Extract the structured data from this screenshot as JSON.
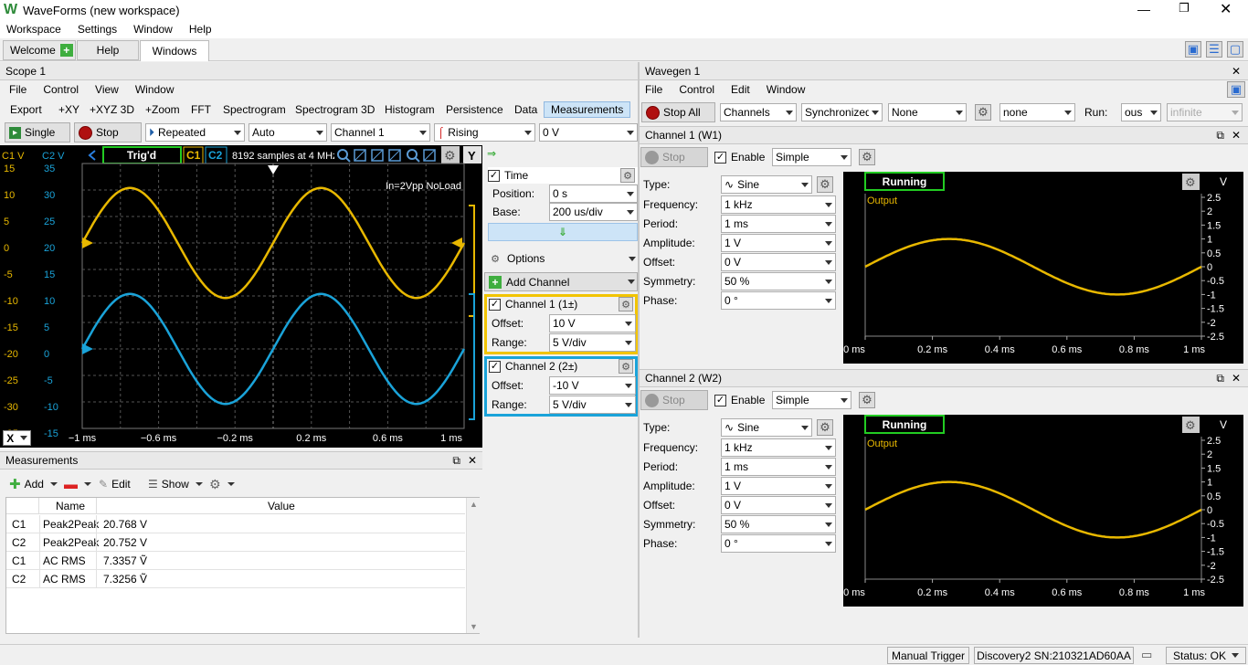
{
  "app": {
    "title": "WaveForms (new workspace)",
    "menu": [
      "Workspace",
      "Settings",
      "Window",
      "Help"
    ],
    "tabs": [
      "Welcome",
      "Help",
      "Windows"
    ]
  },
  "scope": {
    "pane_title": "Scope 1",
    "menu": [
      "File",
      "Control",
      "View",
      "Window"
    ],
    "toolbar": [
      "Export",
      "+XY",
      "+XYZ 3D",
      "+Zoom",
      "FFT",
      "Spectrogram",
      "Spectrogram 3D",
      "Histogram",
      "Persistence",
      "Data",
      "Measurements"
    ],
    "single_label": "Single",
    "stop_label": "Stop",
    "mode": "Repeated",
    "trigger_type": "Auto",
    "trigger_source": "Channel 1",
    "trigger_edge": "Rising",
    "trigger_level": "0 V",
    "c1_unit": "C1 V",
    "c2_unit": "C2 V",
    "status": "Trig'd",
    "c1_tag": "C1",
    "c2_tag": "C2",
    "samples": "8192 samples at 4 MHz",
    "annotation": "In=2Vpp NoLoad",
    "c1_ticks": [
      "15",
      "10",
      "5",
      "0",
      "-5",
      "-10",
      "-15",
      "-20",
      "-25",
      "-30",
      "-35"
    ],
    "c2_ticks": [
      "35",
      "30",
      "25",
      "20",
      "15",
      "10",
      "5",
      "0",
      "-5",
      "-10",
      "-15"
    ],
    "time_ticks": [
      "−1 ms",
      "−0.6 ms",
      "−0.2 ms",
      "0.2 ms",
      "0.6 ms",
      "1 ms"
    ],
    "x_label": "X",
    "colors": {
      "c1": "#e8b800",
      "c2": "#1aa3d9"
    }
  },
  "settings": {
    "time_label": "Time",
    "position_label": "Position:",
    "position": "0 s",
    "base_label": "Base:",
    "base": "200 us/div",
    "options_label": "Options",
    "add_channel_label": "Add Channel",
    "ch1_label": "Channel 1 (1±)",
    "ch1_offset": "10 V",
    "ch1_range": "5 V/div",
    "ch2_label": "Channel 2 (2±)",
    "ch2_offset": "-10 V",
    "ch2_range": "5 V/div",
    "offset_label": "Offset:",
    "range_label": "Range:"
  },
  "measurements": {
    "pane_title": "Measurements",
    "add": "Add",
    "edit": "Edit",
    "show": "Show",
    "headers": [
      "Name",
      "Value"
    ],
    "rows": [
      {
        "ch": "C1",
        "name": "Peak2Peak",
        "value": "20.768 V"
      },
      {
        "ch": "C2",
        "name": "Peak2Peak",
        "value": "20.752 V"
      },
      {
        "ch": "C1",
        "name": "AC RMS",
        "value": "7.3357 Ṽ"
      },
      {
        "ch": "C2",
        "name": "AC RMS",
        "value": "7.3256 Ṽ"
      }
    ]
  },
  "wavegen": {
    "pane_title": "Wavegen 1",
    "menu": [
      "File",
      "Control",
      "Edit",
      "Window"
    ],
    "stop_all": "Stop All",
    "channels": "Channels",
    "sync": "Synchronized",
    "trigger": "None",
    "source": "none",
    "run_label": "Run:",
    "run": "ous",
    "run_count": "infinite",
    "channel_panels": [
      {
        "title": "Channel 1 (W1)",
        "stop": "Stop",
        "enable": "Enable",
        "mode": "Simple",
        "type": "Sine",
        "frequency": "1 kHz",
        "period": "1 ms",
        "amplitude": "1 V",
        "offset": "0 V",
        "symmetry": "50 %",
        "phase": "0 °",
        "status": "Running",
        "output_label": "Output"
      },
      {
        "title": "Channel 2 (W2)",
        "stop": "Stop",
        "enable": "Enable",
        "mode": "Simple",
        "type": "Sine",
        "frequency": "1 kHz",
        "period": "1 ms",
        "amplitude": "1 V",
        "offset": "0 V",
        "symmetry": "50 %",
        "phase": "0 °",
        "status": "Running",
        "output_label": "Output"
      }
    ],
    "labels": {
      "type": "Type:",
      "frequency": "Frequency:",
      "period": "Period:",
      "amplitude": "Amplitude:",
      "offset": "Offset:",
      "symmetry": "Symmetry:",
      "phase": "Phase:"
    },
    "plot_unit": "V",
    "y_ticks": [
      "2.5",
      "2",
      "1.5",
      "1",
      "0.5",
      "0",
      "-0.5",
      "-1",
      "-1.5",
      "-2",
      "-2.5"
    ],
    "x_ticks": [
      "0 ms",
      "0.2 ms",
      "0.4 ms",
      "0.6 ms",
      "0.8 ms",
      "1 ms"
    ],
    "color": "#e8b800"
  },
  "statusbar": {
    "manual_trigger": "Manual Trigger",
    "device": "Discovery2 SN:210321AD60AA",
    "status": "Status: OK"
  }
}
